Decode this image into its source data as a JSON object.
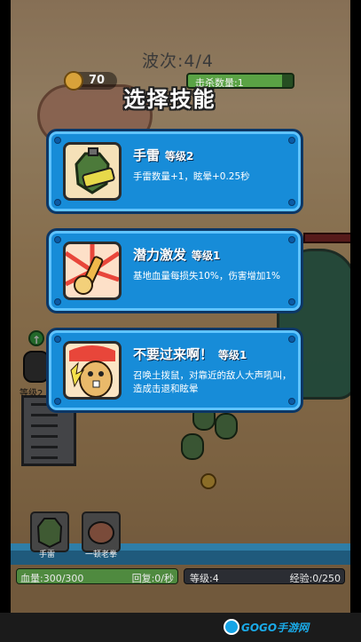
{
  "hud": {
    "wave": "波次:4/4",
    "coins": "70",
    "kill_label": "击杀数量:1",
    "kill_progress": 0.9,
    "choose_title": "选择技能"
  },
  "skills": [
    {
      "name": "手雷",
      "level": "等级2",
      "desc": "手雷数量+1，眩晕+0.25秒",
      "icon": "grenade-icon"
    },
    {
      "name": "潜力激发",
      "level": "等级1",
      "desc": "基地血量每损失10%，伤害增加1%",
      "icon": "potential-icon"
    },
    {
      "name": "不要过来啊！",
      "level": "等级1",
      "desc": "召唤土拨鼠，对靠近的敌人大声吼叫，造成击退和眩晕",
      "icon": "gopher-icon"
    }
  ],
  "scene": {
    "hero_level": "等级2"
  },
  "slots": [
    {
      "label": "手雷",
      "icon": "grenade-slot-icon"
    },
    {
      "label": "一顿老拳",
      "icon": "fist-slot-icon"
    }
  ],
  "status": {
    "hp": "血量:300/300",
    "hp_fraction": 1.0,
    "regen": "回复:0/秒",
    "level": "等级:4",
    "exp": "经验:0/250",
    "exp_fraction": 0.0
  },
  "watermark": {
    "text": "GOGO手游网"
  },
  "colors": {
    "card_blue": "#178cd8",
    "card_border": "#0c3766",
    "hp_green": "#4f8a3f",
    "brand": "#1aaae8"
  }
}
